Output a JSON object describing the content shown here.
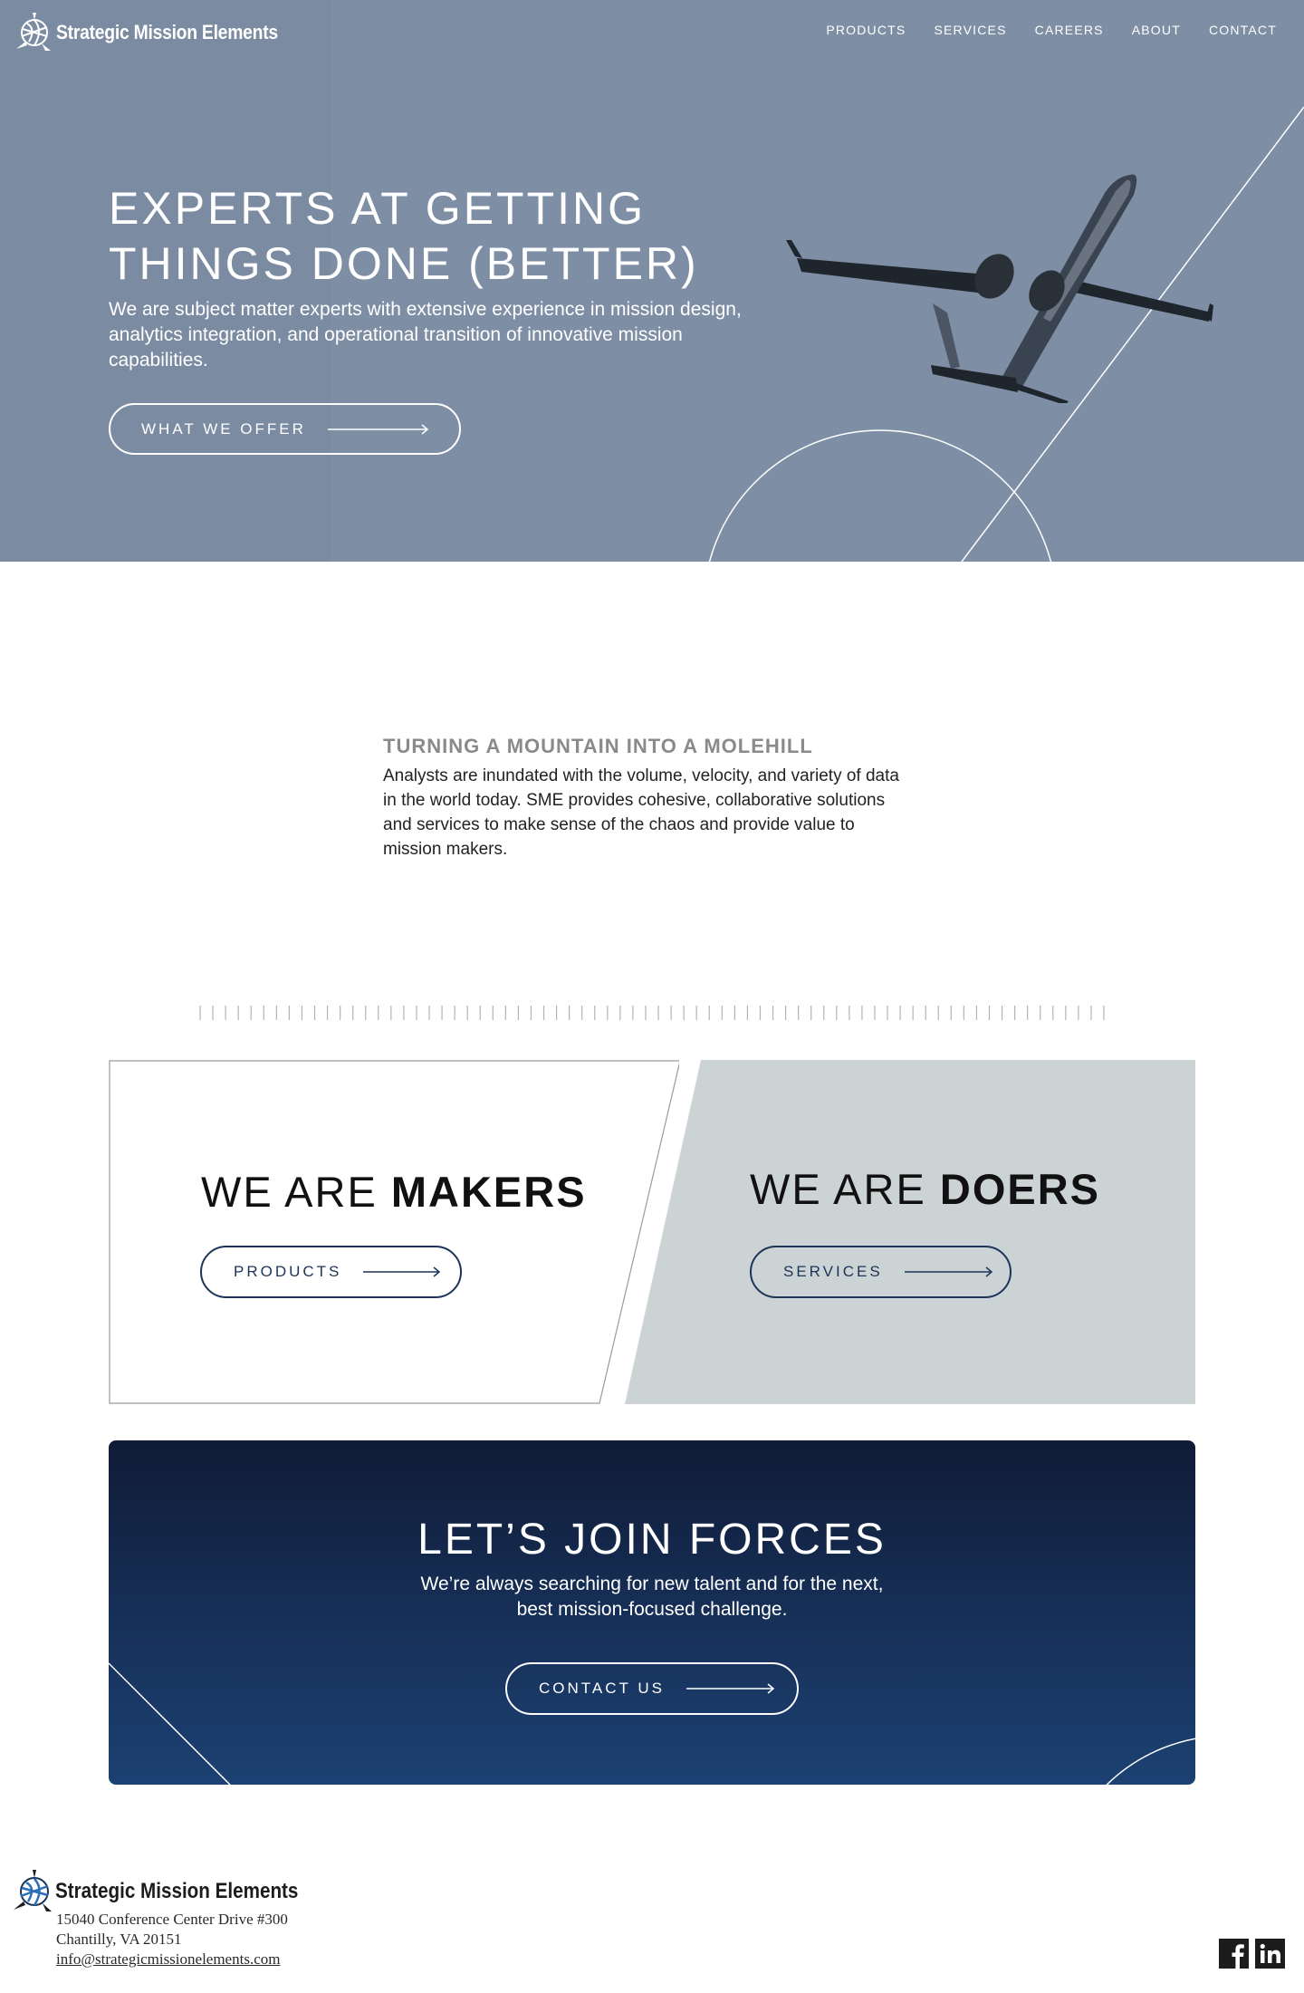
{
  "brand": {
    "name": "Strategic Mission Elements"
  },
  "nav": {
    "items": [
      "PRODUCTS",
      "SERVICES",
      "CAREERS",
      "ABOUT",
      "CONTACT"
    ]
  },
  "hero": {
    "title_line1": "EXPERTS AT GETTING",
    "title_line2": "THINGS DONE (BETTER)",
    "subtitle": "We are subject matter experts with extensive experience in mission design, analytics integration, and operational transition of innovative mission capabilities.",
    "button_label": "WHAT WE OFFER"
  },
  "intro": {
    "title": "TURNING A MOUNTAIN INTO A MOLEHILL",
    "text": "Analysts are inundated with the volume, velocity, and variety of data in the world today. SME provides cohesive, collaborative solutions and services to make sense of the chaos and provide value to mission makers."
  },
  "makers": {
    "lead": "WE ARE ",
    "bold": "MAKERS",
    "button_label": "PRODUCTS"
  },
  "doers": {
    "lead": "WE ARE ",
    "bold": "DOERS",
    "button_label": "SERVICES"
  },
  "cta": {
    "title": "LET’S JOIN FORCES",
    "subtitle_line1": "We’re always searching for new talent and for the next,",
    "subtitle_line2": "best mission-focused challenge.",
    "button_label": "CONTACT US"
  },
  "footer": {
    "brand": "Strategic Mission Elements",
    "address_line1": "15040 Conference Center Drive #300",
    "address_line2": "Chantilly, VA 20151",
    "email": "info@strategicmissionelements.com"
  },
  "icons": {
    "logo": "globe-logo-icon",
    "arrow": "arrow-right-icon",
    "facebook": "facebook-icon",
    "linkedin": "linkedin-icon",
    "plane": "airplane-image"
  },
  "colors": {
    "hero_bg": "#7e8ea4",
    "navy": "#1c3459",
    "doers_bg": "#ccd3d4",
    "cta_top": "#101b36",
    "cta_bottom": "#1c4172",
    "intro_title": "#8a8a8a"
  }
}
